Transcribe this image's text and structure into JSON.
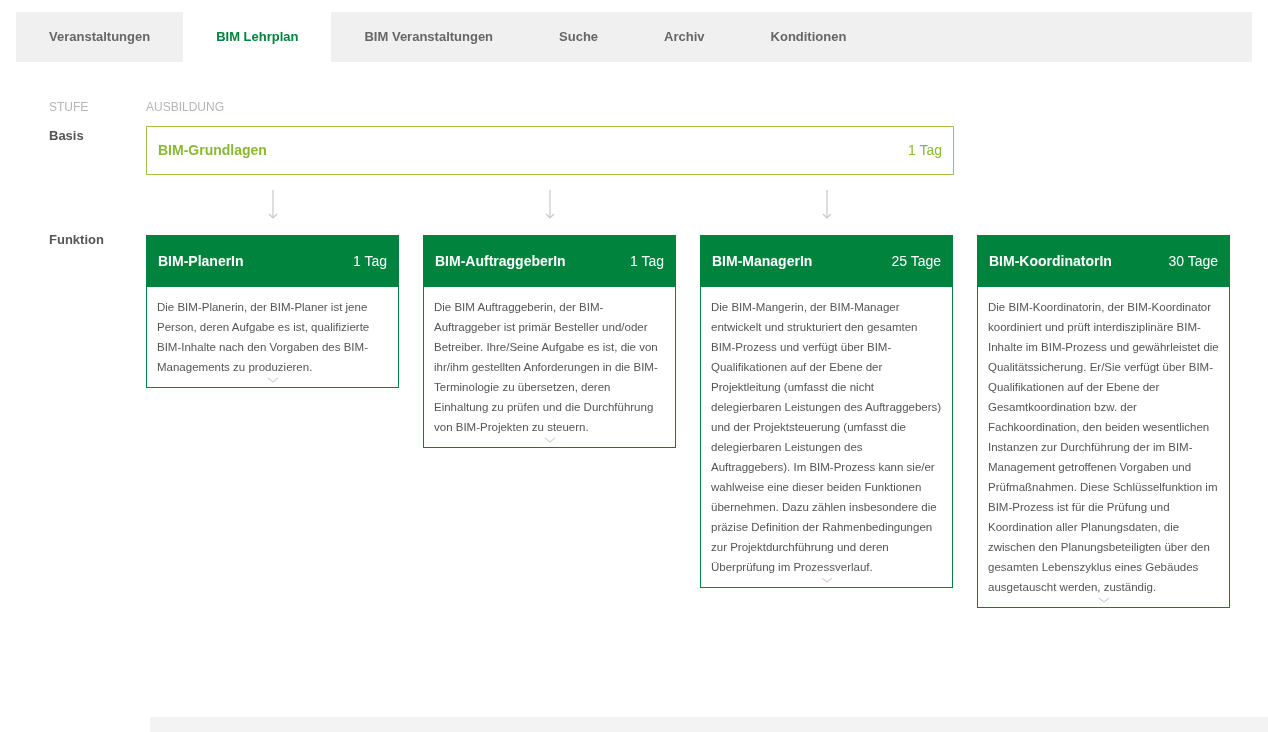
{
  "tabs": [
    {
      "label": "Veranstaltungen",
      "selected": false
    },
    {
      "label": "BIM Lehrplan",
      "selected": true
    },
    {
      "label": "BIM Veranstaltungen",
      "selected": false
    },
    {
      "label": "Suche",
      "selected": false
    },
    {
      "label": "Archiv",
      "selected": false
    },
    {
      "label": "Konditionen",
      "selected": false
    }
  ],
  "headers": {
    "level": "STUFE",
    "training": "AUSBILDUNG"
  },
  "basis": {
    "label": "Basis",
    "course": {
      "title": "BIM-Grundlagen",
      "duration": "1 Tag"
    }
  },
  "function": {
    "label": "Funktion",
    "cards": [
      {
        "title": "BIM-PlanerIn",
        "duration": "1 Tag",
        "linked": true,
        "description": "Die BIM-Planerin, der BIM-Planer ist jene Person, deren Aufgabe es ist, qualifizierte BIM-Inhalte nach den Vorgaben des BIM-Managements zu produzieren."
      },
      {
        "title": "BIM-AuftraggeberIn",
        "duration": "1 Tag",
        "linked": true,
        "description": "Die BIM Auftraggeberin, der BIM-Auftraggeber ist primär Besteller und/oder Betreiber. Ihre/Seine Aufgabe es ist, die von ihr/ihm gestellten Anforderungen in die BIM-Terminologie zu übersetzen, deren Einhaltung zu prüfen und die Durchführung von BIM-Projekten zu steuern."
      },
      {
        "title": "BIM-ManagerIn",
        "duration": "25 Tage",
        "linked": true,
        "description": "Die BIM-Mangerin, der BIM-Manager entwickelt und strukturiert den gesamten BIM-Prozess und verfügt über BIM-Qualifikationen auf der Ebene der Projektleitung (umfasst die nicht delegierbaren Leistungen des Auftraggebers) und der Projektsteuerung (umfasst die delegierbaren Leistungen des Auftraggebers). Im BIM-Prozess kann sie/er wahlweise eine dieser beiden Funktionen übernehmen. Dazu zählen insbesondere die präzise Definition der Rahmenbedingungen zur Projektdurchführung und deren Überprüfung im Prozessverlauf."
      },
      {
        "title": "BIM-KoordinatorIn",
        "duration": "30 Tage",
        "linked": false,
        "description": "Die BIM-Koordinatorin, der BIM-Koordinator koordiniert und prüft interdisziplinäre BIM-Inhalte im BIM-Prozess und gewährleistet die Qualitätssicherung. Er/Sie verfügt über BIM-Qualifikationen auf der Ebene der Gesamtkoordination bzw. der Fachkoordination, den beiden wesentlichen Instanzen zur Durchführung der im BIM-Management getroffenen Vorgaben und Prüfmaßnahmen. Diese Schlüsselfunktion im BIM-Prozess ist für die Prüfung und Koordination aller Planungsdaten, die zwischen den Planungsbeteiligten über den gesamten Lebenszyklus eines Gebäudes ausgetauscht werden, zuständig."
      }
    ]
  }
}
